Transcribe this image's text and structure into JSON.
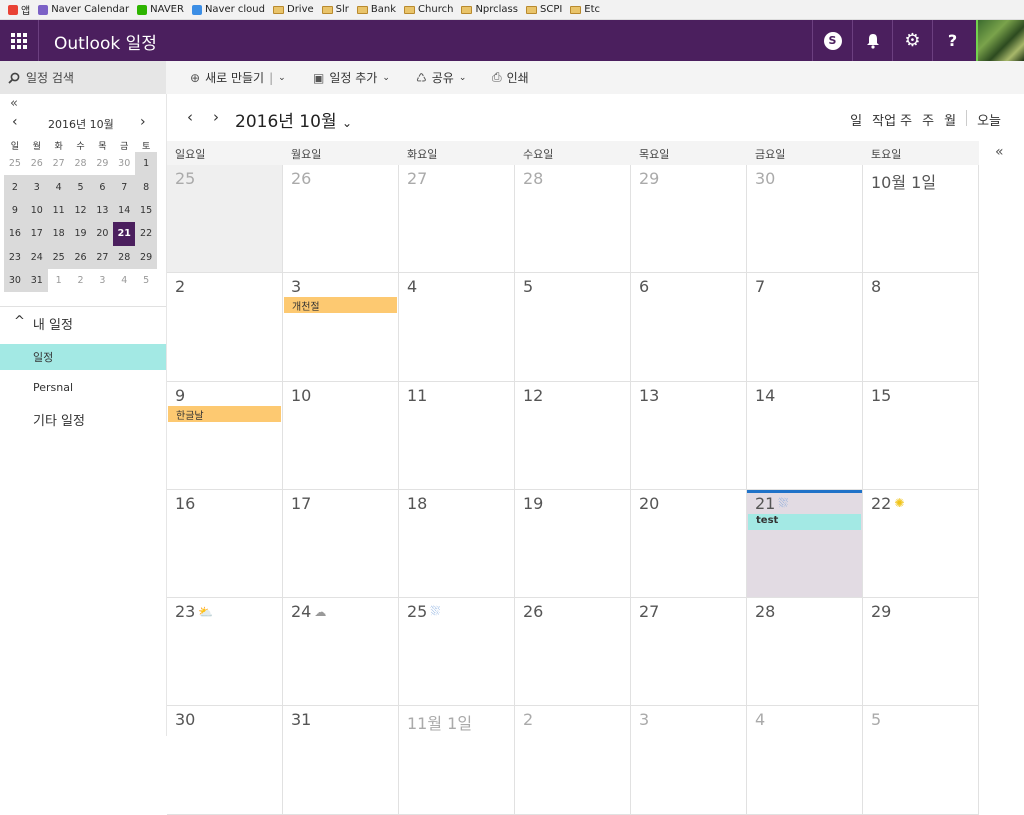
{
  "bookmarks": [
    {
      "label": "앱",
      "icon": "apps-icon",
      "color": "#e94235"
    },
    {
      "label": "Naver Calendar",
      "icon": "calendar-icon",
      "color": "#7b61c6"
    },
    {
      "label": "NAVER",
      "icon": "naver-icon",
      "color": "#2db400"
    },
    {
      "label": "Naver cloud",
      "icon": "cloud-icon",
      "color": "#3c8ee5"
    },
    {
      "label": "Drive",
      "icon": "folder-icon"
    },
    {
      "label": "Slr",
      "icon": "folder-icon"
    },
    {
      "label": "Bank",
      "icon": "folder-icon"
    },
    {
      "label": "Church",
      "icon": "folder-icon"
    },
    {
      "label": "Nprclass",
      "icon": "folder-icon"
    },
    {
      "label": "SCPI",
      "icon": "folder-icon"
    },
    {
      "label": "Etc",
      "icon": "folder-icon"
    }
  ],
  "header": {
    "title": "Outlook 일정",
    "bg": "#4b1f5e",
    "buttons": [
      {
        "name": "skype-icon",
        "glyph": "S"
      },
      {
        "name": "bell-icon",
        "glyph": "🔔"
      },
      {
        "name": "gear-icon",
        "glyph": "⚙"
      },
      {
        "name": "help-icon",
        "glyph": "?"
      }
    ]
  },
  "toolbar": {
    "search_placeholder": "일정 검색",
    "new_label": "새로 만들기",
    "add_label": "일정 추가",
    "share_label": "공유",
    "print_label": "인쇄"
  },
  "mini_calendar": {
    "title": "2016년 10월",
    "dow": [
      "일",
      "월",
      "화",
      "수",
      "목",
      "금",
      "토"
    ],
    "weeks": [
      [
        "25",
        "26",
        "27",
        "28",
        "29",
        "30",
        "1"
      ],
      [
        "2",
        "3",
        "4",
        "5",
        "6",
        "7",
        "8"
      ],
      [
        "9",
        "10",
        "11",
        "12",
        "13",
        "14",
        "15"
      ],
      [
        "16",
        "17",
        "18",
        "19",
        "20",
        "21",
        "22"
      ],
      [
        "23",
        "24",
        "25",
        "26",
        "27",
        "28",
        "29"
      ],
      [
        "30",
        "31",
        "1",
        "2",
        "3",
        "4",
        "5"
      ]
    ],
    "today": "21"
  },
  "sidebar": {
    "my_calendars": "내 일정",
    "calendars": [
      "일정",
      "Persnal"
    ],
    "selected": "일정",
    "other": "기타 일정"
  },
  "main": {
    "title": "2016년 10월",
    "views": [
      "일",
      "작업 주",
      "주",
      "월"
    ],
    "today_btn": "오늘",
    "dow": [
      "일요일",
      "월요일",
      "화요일",
      "수요일",
      "목요일",
      "금요일",
      "토요일"
    ]
  },
  "weeks": [
    [
      {
        "d": "25",
        "other": true,
        "past": true
      },
      {
        "d": "26",
        "other": true
      },
      {
        "d": "27",
        "other": true
      },
      {
        "d": "28",
        "other": true
      },
      {
        "d": "29",
        "other": true
      },
      {
        "d": "30",
        "other": true
      },
      {
        "d": "10월 1일"
      }
    ],
    [
      {
        "d": "2"
      },
      {
        "d": "3",
        "event": "개천절",
        "etype": "holiday"
      },
      {
        "d": "4"
      },
      {
        "d": "5"
      },
      {
        "d": "6"
      },
      {
        "d": "7"
      },
      {
        "d": "8"
      }
    ],
    [
      {
        "d": "9",
        "event": "한글날",
        "etype": "holiday"
      },
      {
        "d": "10"
      },
      {
        "d": "11"
      },
      {
        "d": "12"
      },
      {
        "d": "13"
      },
      {
        "d": "14"
      },
      {
        "d": "15"
      }
    ],
    [
      {
        "d": "16"
      },
      {
        "d": "17"
      },
      {
        "d": "18"
      },
      {
        "d": "19"
      },
      {
        "d": "20"
      },
      {
        "d": "21",
        "today": true,
        "weather": "rain",
        "event": "test",
        "etype": "user"
      },
      {
        "d": "22",
        "weather": "sun"
      }
    ],
    [
      {
        "d": "23",
        "weather": "partly-sunny"
      },
      {
        "d": "24",
        "weather": "cloud"
      },
      {
        "d": "25",
        "weather": "rain"
      },
      {
        "d": "26"
      },
      {
        "d": "27"
      },
      {
        "d": "28"
      },
      {
        "d": "29"
      }
    ],
    [
      {
        "d": "30"
      },
      {
        "d": "31"
      },
      {
        "d": "11월 1일",
        "other": true
      },
      {
        "d": "2",
        "other": true
      },
      {
        "d": "3",
        "other": true
      },
      {
        "d": "4",
        "other": true
      },
      {
        "d": "5",
        "other": true
      }
    ]
  ]
}
